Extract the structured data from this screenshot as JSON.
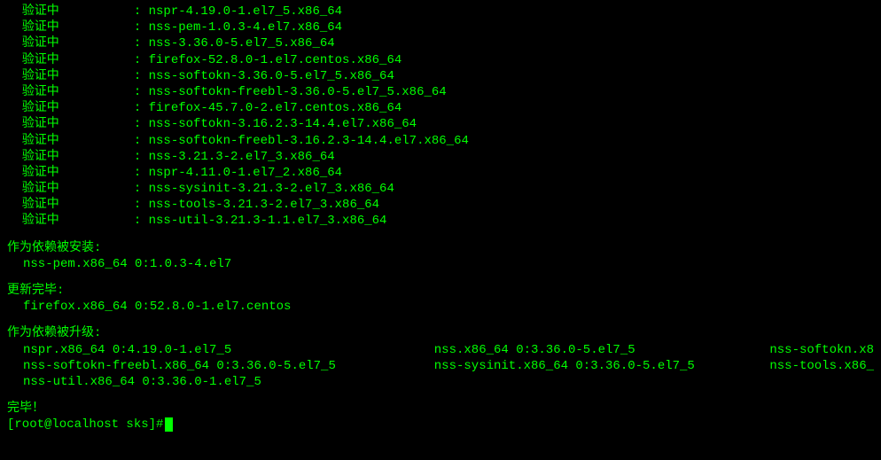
{
  "verify_label": "验证中",
  "verify_lines": [
    "nspr-4.19.0-1.el7_5.x86_64",
    "nss-pem-1.0.3-4.el7.x86_64",
    "nss-3.36.0-5.el7_5.x86_64",
    "firefox-52.8.0-1.el7.centos.x86_64",
    "nss-softokn-3.36.0-5.el7_5.x86_64",
    "nss-softokn-freebl-3.36.0-5.el7_5.x86_64",
    "firefox-45.7.0-2.el7.centos.x86_64",
    "nss-softokn-3.16.2.3-14.4.el7.x86_64",
    "nss-softokn-freebl-3.16.2.3-14.4.el7.x86_64",
    "nss-3.21.3-2.el7_3.x86_64",
    "nspr-4.11.0-1.el7_2.x86_64",
    "nss-sysinit-3.21.3-2.el7_3.x86_64",
    "nss-tools-3.21.3-2.el7_3.x86_64",
    "nss-util-3.21.3-1.1.el7_3.x86_64"
  ],
  "sections": {
    "dep_installed_header": "作为依赖被安装:",
    "dep_installed_item": "nss-pem.x86_64 0:1.0.3-4.el7",
    "updated_header": "更新完毕:",
    "updated_item": "firefox.x86_64 0:52.8.0-1.el7.centos",
    "dep_upgraded_header": "作为依赖被升级:"
  },
  "upgrade_rows": [
    {
      "col1": "nspr.x86_64 0:4.19.0-1.el7_5",
      "col2": "nss.x86_64 0:3.36.0-5.el7_5",
      "col3": "nss-softokn.x8"
    },
    {
      "col1": "nss-softokn-freebl.x86_64 0:3.36.0-5.el7_5",
      "col2": "nss-sysinit.x86_64 0:3.36.0-5.el7_5",
      "col3": "nss-tools.x86_"
    },
    {
      "col1": "nss-util.x86_64 0:3.36.0-1.el7_5",
      "col2": "",
      "col3": ""
    }
  ],
  "complete": "完毕！",
  "prompt": "[root@localhost sks]# "
}
